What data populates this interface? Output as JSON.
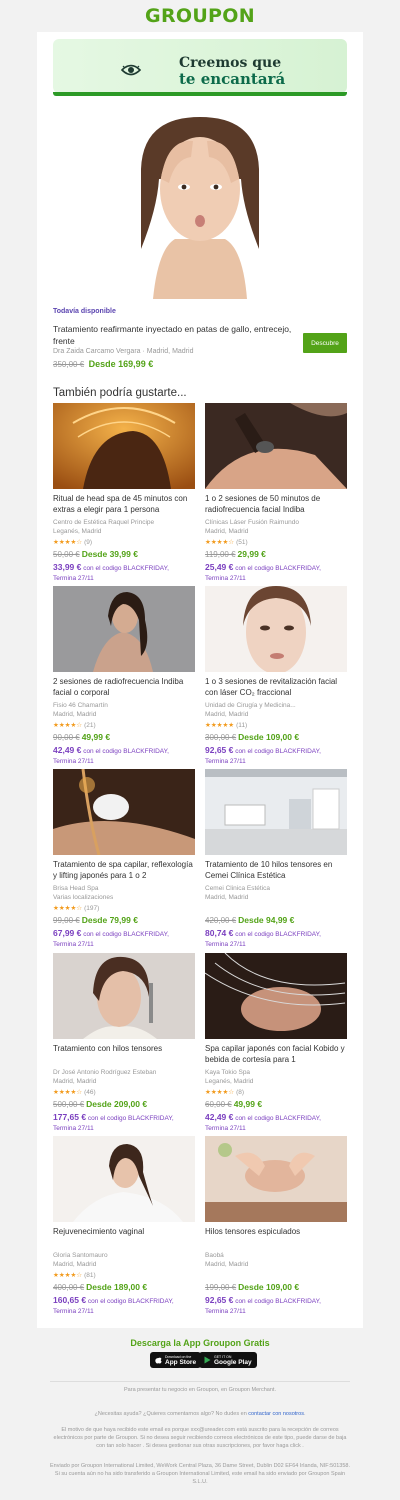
{
  "brand": "GROUPON",
  "banner": {
    "line1": "Creemos que",
    "line2": "te encantará"
  },
  "hero": {
    "availability": "Todavía disponible",
    "title": "Tratamiento reafirmante inyectado en patas de gallo, entrecejo, frente",
    "merchant": "Dra Zaida Carcamo Vergara",
    "location": "Madrid, Madrid",
    "old_price": "350,00 €",
    "price": "Desde 169,99 €",
    "button": "Descubre"
  },
  "section_title": "También podría gustarte...",
  "promo_suffix": "con el codigo BLACKFRIDAY,",
  "promo_end": "Termina 27/11",
  "items": [
    {
      "title": "Ritual de head spa de 45 minutos con extras a elegir para 1 persona",
      "merchant": "Centro de Estética Raquel Principe",
      "location": "Leganés, Madrid",
      "stars": "★★★★☆",
      "reviews": "(9)",
      "old_price": "50,00 €",
      "price": "Desde 39,99 €",
      "promo_price": "33,99 €"
    },
    {
      "title": "1 o 2 sesiones de 50 minutos de radiofrecuencia facial Indiba",
      "merchant": "Clínicas Láser Fusión Raimundo",
      "location": "Madrid, Madrid",
      "stars": "★★★★☆",
      "reviews": "(51)",
      "old_price": "119,00 €",
      "price": "29,99 €",
      "promo_price": "25,49 €"
    },
    {
      "title": "2 sesiones de radiofrecuencia Indiba facial o corporal",
      "merchant": "Fisio 46 Chamartín",
      "location": "Madrid, Madrid",
      "stars": "★★★★☆",
      "reviews": "(21)",
      "old_price": "90,00 €",
      "price": "49,99 €",
      "promo_price": "42,49 €"
    },
    {
      "title": "1 o 3 sesiones de revitalización facial con láser CO₂ fraccional",
      "merchant": "Unidad de Cirugía y Medicina...",
      "location": "Madrid, Madrid",
      "stars": "★★★★★",
      "reviews": "(11)",
      "old_price": "300,00 €",
      "price": "Desde 109,00 €",
      "promo_price": "92,65 €"
    },
    {
      "title": "Tratamiento de spa capilar, reflexología y lifting japonés para 1 o 2",
      "merchant": "Brisa Head Spa",
      "location": "Varias localizaciones",
      "stars": "★★★★☆",
      "reviews": "(197)",
      "old_price": "99,00 €",
      "price": "Desde 79,99 €",
      "promo_price": "67,99 €"
    },
    {
      "title": "Tratamiento de 10 hilos tensores en Cemei Clínica Estética",
      "merchant": "Cemei Clinica Estética",
      "location": "Madrid, Madrid",
      "stars": "",
      "reviews": "",
      "old_price": "420,00 €",
      "price": "Desde 94,99 €",
      "promo_price": "80,74 €"
    },
    {
      "title": "Tratamiento con hilos tensores",
      "merchant": "Dr José Antonio Rodríguez Esteban",
      "location": "Madrid, Madrid",
      "stars": "★★★★☆",
      "reviews": "(46)",
      "old_price": "500,00 €",
      "price": "Desde 209,00 €",
      "promo_price": "177,65 €"
    },
    {
      "title": "Spa capilar japonés con facial Kobido y bebida de cortesía para 1",
      "merchant": "Kaya Tokio Spa",
      "location": "Leganés, Madrid",
      "stars": "★★★★☆",
      "reviews": "(8)",
      "old_price": "60,00 €",
      "price": "49,99 €",
      "promo_price": "42,49 €"
    },
    {
      "title": "Rejuvenecimiento vaginal",
      "merchant": "Gloria Santomauro",
      "location": "Madrid, Madrid",
      "stars": "★★★★☆",
      "reviews": "(81)",
      "old_price": "400,00 €",
      "price": "Desde 189,00 €",
      "promo_price": "160,65 €"
    },
    {
      "title": "Hilos tensores espiculados",
      "merchant": "Baobá",
      "location": "Madrid, Madrid",
      "stars": "",
      "reviews": "",
      "old_price": "199,00 €",
      "price": "Desde 109,00 €",
      "promo_price": "92,65 €"
    }
  ],
  "footer": {
    "download": "Descarga la App Groupon Gratis",
    "appstore_small": "Download on the",
    "appstore_big": "App Store",
    "googleplay_small": "GET IT ON",
    "googleplay_big": "Google Play",
    "merchant_text": "Para presentar tu negocio en Groupon, en Groupon Merchant.",
    "help_text": "¿Necesitas ayuda? ¿Quieres comentarnos algo? No dudes en",
    "help_link": "contactar con nosotros",
    "reason_text": "El motivo de que haya recibido este email es porque xxx@ureader.com está suscrito para la recepción de correos electrónicos por parte de Groupon. Si no desea seguir recibiendo correos electrónicos de este tipo, puede darse de baja con tan solo hacer . Si desea gestionar sus otras suscripciones, por favor haga click .",
    "legal_text": "Enviado por Groupon International Limited, WeWork Central Plaza, 36 Dame Street, Dublin D02 EF64 Irlanda, NIF:501358. Si su cuenta aún no ha sido transferido a Groupon International Limited, este email ha sido enviado por Groupon Spain S.L.U."
  }
}
